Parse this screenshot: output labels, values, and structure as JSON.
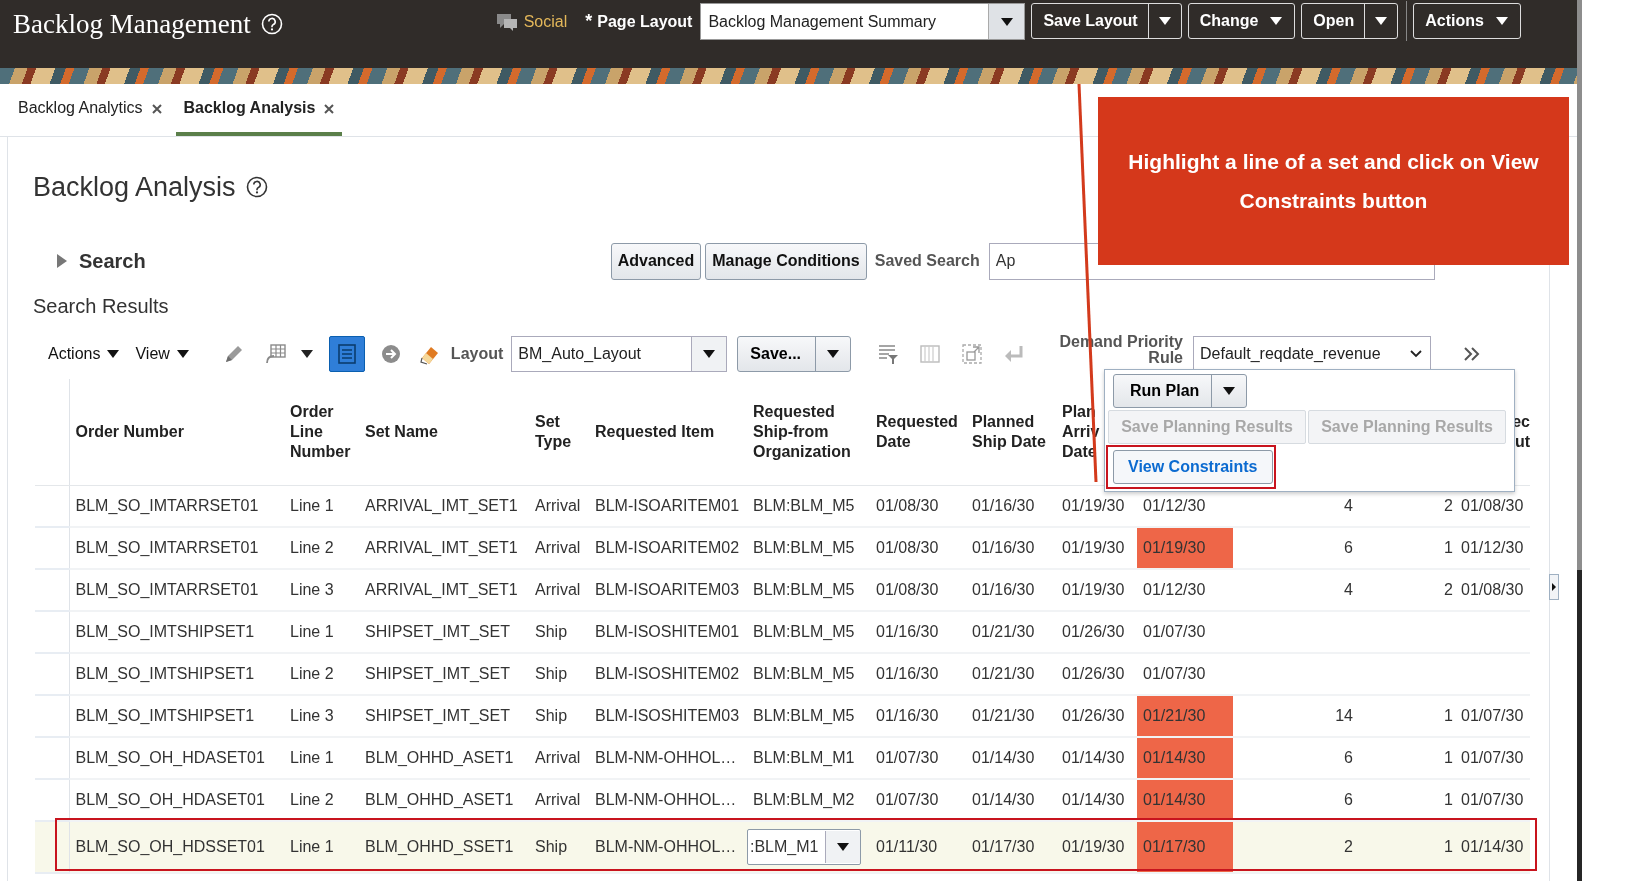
{
  "header": {
    "title": "Backlog Management",
    "social": "Social",
    "modified_mark": "*",
    "page_layout_label": "Page Layout",
    "layout_select": "Backlog Management Summary",
    "buttons": [
      {
        "label": "Save Layout",
        "split": true
      },
      {
        "label": "Change",
        "split": false
      },
      {
        "label": "Open",
        "split": true
      },
      {
        "label": "Actions",
        "split": false
      }
    ]
  },
  "tabs": [
    {
      "label": "Backlog Analytics",
      "selected": false
    },
    {
      "label": "Backlog Analysis",
      "selected": true
    }
  ],
  "page_title": "Backlog Analysis",
  "search": {
    "label": "Search",
    "expanded": false,
    "buttons": [
      {
        "label": "Advanced"
      },
      {
        "label": "Manage Conditions"
      }
    ],
    "saved_search_label": "Saved Search",
    "saved_search_value": "Ap"
  },
  "results": {
    "title": "Search Results",
    "toolbar": {
      "menus": [
        "Actions",
        "View"
      ],
      "view_toggle_on": true,
      "layout_label": "Layout",
      "layout_value": "BM_Auto_Layout",
      "save_label": "Save...",
      "priority_label": "Demand Priority Rule",
      "priority_value": "Default_reqdate_revenue"
    },
    "columns": [
      "Order Number",
      "Order Line Number",
      "Set Name",
      "Set Type",
      "Requested Item",
      "Requested Ship-from Organization",
      "Requested Date",
      "Planned Ship Date",
      "Plan Arriv Date",
      null,
      null,
      null,
      "ec ut"
    ],
    "rows": [
      {
        "cells": [
          "BLM_SO_IMTARRSET01",
          "Line 1",
          "ARRIVAL_IMT_SET1",
          "Arrival",
          "BLM-ISOARITEM01",
          "BLM:BLM_M5",
          "01/08/30",
          "01/16/30",
          "01/19/30",
          "01/12/30",
          "4",
          "2",
          "01/08/30"
        ],
        "alert": false,
        "selected": false,
        "editing": false
      },
      {
        "cells": [
          "BLM_SO_IMTARRSET01",
          "Line 2",
          "ARRIVAL_IMT_SET1",
          "Arrival",
          "BLM-ISOARITEM02",
          "BLM:BLM_M5",
          "01/08/30",
          "01/16/30",
          "01/19/30",
          "01/19/30",
          "6",
          "1",
          "01/12/30"
        ],
        "alert": true,
        "selected": false,
        "editing": false
      },
      {
        "cells": [
          "BLM_SO_IMTARRSET01",
          "Line 3",
          "ARRIVAL_IMT_SET1",
          "Arrival",
          "BLM-ISOARITEM03",
          "BLM:BLM_M5",
          "01/08/30",
          "01/16/30",
          "01/19/30",
          "01/12/30",
          "4",
          "2",
          "01/08/30"
        ],
        "alert": false,
        "selected": false,
        "editing": false
      },
      {
        "cells": [
          "BLM_SO_IMTSHIPSET1",
          "Line 1",
          "SHIPSET_IMT_SET",
          "Ship",
          "BLM-ISOSHITEM01",
          "BLM:BLM_M5",
          "01/16/30",
          "01/21/30",
          "01/26/30",
          "01/07/30",
          null,
          null,
          null
        ],
        "alert": false,
        "selected": false,
        "editing": false
      },
      {
        "cells": [
          "BLM_SO_IMTSHIPSET1",
          "Line 2",
          "SHIPSET_IMT_SET",
          "Ship",
          "BLM-ISOSHITEM02",
          "BLM:BLM_M5",
          "01/16/30",
          "01/21/30",
          "01/26/30",
          "01/07/30",
          null,
          null,
          null
        ],
        "alert": false,
        "selected": false,
        "editing": false
      },
      {
        "cells": [
          "BLM_SO_IMTSHIPSET1",
          "Line 3",
          "SHIPSET_IMT_SET",
          "Ship",
          "BLM-ISOSHITEM03",
          "BLM:BLM_M5",
          "01/16/30",
          "01/21/30",
          "01/26/30",
          "01/21/30",
          "14",
          "1",
          "01/07/30"
        ],
        "alert": true,
        "selected": false,
        "editing": false
      },
      {
        "cells": [
          "BLM_SO_OH_HDASET01",
          "Line 1",
          "BLM_OHHD_ASET1",
          "Arrival",
          "BLM-NM-OHHOL…",
          "BLM:BLM_M1",
          "01/07/30",
          "01/14/30",
          "01/14/30",
          "01/14/30",
          "6",
          "1",
          "01/07/30"
        ],
        "alert": true,
        "selected": false,
        "editing": false
      },
      {
        "cells": [
          "BLM_SO_OH_HDASET01",
          "Line 2",
          "BLM_OHHD_ASET1",
          "Arrival",
          "BLM-NM-OHHOL…",
          "BLM:BLM_M2",
          "01/07/30",
          "01/14/30",
          "01/14/30",
          "01/14/30",
          "6",
          "1",
          "01/07/30"
        ],
        "alert": true,
        "selected": false,
        "editing": false
      },
      {
        "cells": [
          "BLM_SO_OH_HDSSET01",
          "Line 1",
          "BLM_OHHD_SSET1",
          "Ship",
          "BLM-NM-OHHOL…",
          ":BLM_M1",
          "01/11/30",
          "01/17/30",
          "01/19/30",
          "01/17/30",
          "2",
          "1",
          "01/14/30"
        ],
        "alert": true,
        "selected": true,
        "editing": true
      }
    ]
  },
  "popup": {
    "run_plan": "Run Plan",
    "save_buttons": [
      {
        "label": "Save Planning Results",
        "disabled": true
      },
      {
        "label": "Save Planning Results",
        "disabled": true
      }
    ],
    "view_constraints": "View Constraints"
  },
  "callout": {
    "text": "Highlight a line of a set and click on View Constraints button"
  }
}
